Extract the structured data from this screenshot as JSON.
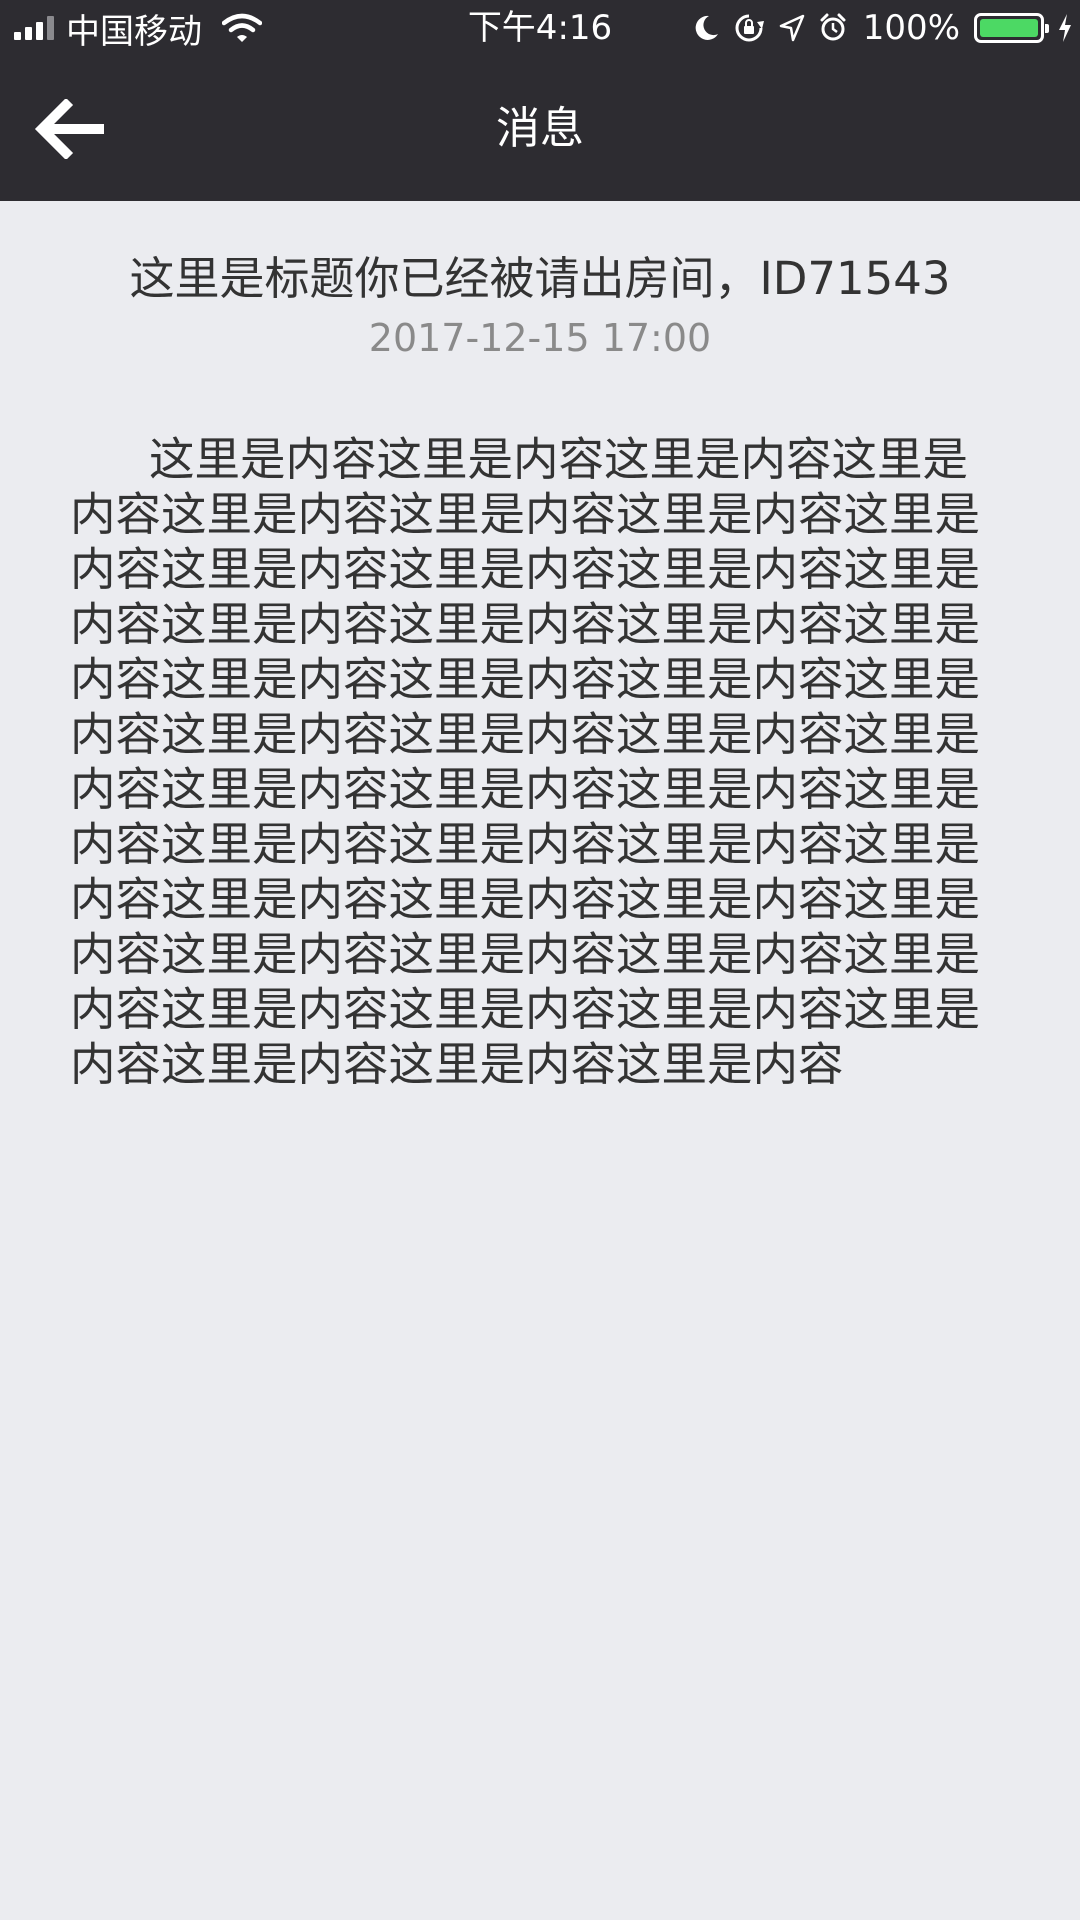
{
  "status_bar": {
    "carrier": "中国移动",
    "time": "下午4:16",
    "battery_percent": "100%",
    "battery_level": 1.0,
    "icons": [
      "signal-icon",
      "wifi-icon",
      "moon-icon",
      "rotation-lock-icon",
      "location-icon",
      "alarm-icon",
      "battery-icon",
      "charging-icon"
    ]
  },
  "nav": {
    "title": "消息",
    "back_icon": "back-arrow-icon"
  },
  "message": {
    "title": "这里是标题你已经被请出房间，ID71543",
    "time": "2017-12-15 17:00",
    "content": "这里是内容这里是内容这里是内容这里是内容这里是内容这里是内容这里是内容这里是内容这里是内容这里是内容这里是内容这里是内容这里是内容这里是内容这里是内容这里是内容这里是内容这里是内容这里是内容这里是内容这里是内容这里是内容这里是内容这里是内容这里是内容这里是内容这里是内容这里是内容这里是内容这里是内容这里是内容这里是内容这里是内容这里是内容这里是内容这里是内容这里是内容这里是内容这里是内容这里是内容这里是内容这里是内容这里是内容这里是内容这里是内容这里是内容这里是内容"
  },
  "colors": {
    "header_bg": "#2d2c31",
    "page_bg": "#ebecf0",
    "text_primary": "#333333",
    "text_secondary": "#8a8a8a",
    "battery_fill": "#4cd964"
  }
}
